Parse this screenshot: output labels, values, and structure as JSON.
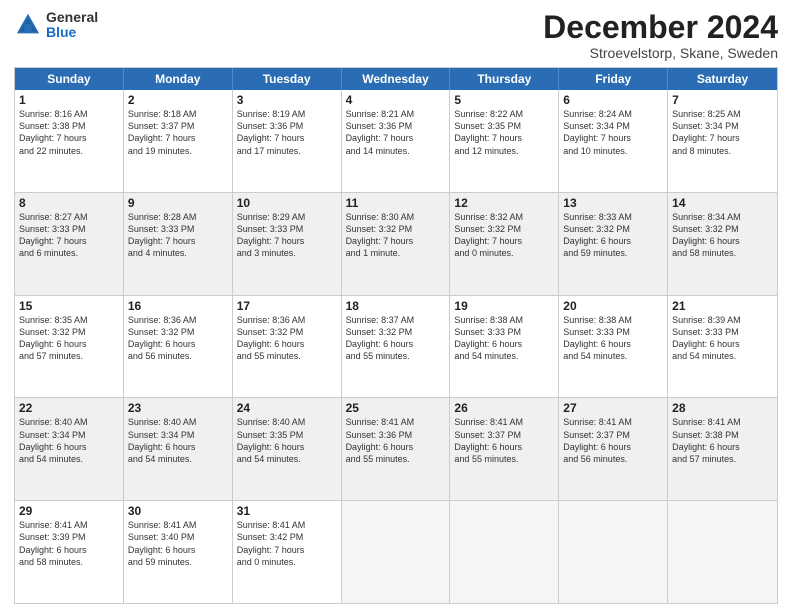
{
  "header": {
    "logo_general": "General",
    "logo_blue": "Blue",
    "title": "December 2024",
    "location": "Stroevelstorp, Skane, Sweden"
  },
  "days_of_week": [
    "Sunday",
    "Monday",
    "Tuesday",
    "Wednesday",
    "Thursday",
    "Friday",
    "Saturday"
  ],
  "weeks": [
    [
      {
        "day": "1",
        "shade": false,
        "lines": [
          "Sunrise: 8:16 AM",
          "Sunset: 3:38 PM",
          "Daylight: 7 hours",
          "and 22 minutes."
        ]
      },
      {
        "day": "2",
        "shade": false,
        "lines": [
          "Sunrise: 8:18 AM",
          "Sunset: 3:37 PM",
          "Daylight: 7 hours",
          "and 19 minutes."
        ]
      },
      {
        "day": "3",
        "shade": false,
        "lines": [
          "Sunrise: 8:19 AM",
          "Sunset: 3:36 PM",
          "Daylight: 7 hours",
          "and 17 minutes."
        ]
      },
      {
        "day": "4",
        "shade": false,
        "lines": [
          "Sunrise: 8:21 AM",
          "Sunset: 3:36 PM",
          "Daylight: 7 hours",
          "and 14 minutes."
        ]
      },
      {
        "day": "5",
        "shade": false,
        "lines": [
          "Sunrise: 8:22 AM",
          "Sunset: 3:35 PM",
          "Daylight: 7 hours",
          "and 12 minutes."
        ]
      },
      {
        "day": "6",
        "shade": false,
        "lines": [
          "Sunrise: 8:24 AM",
          "Sunset: 3:34 PM",
          "Daylight: 7 hours",
          "and 10 minutes."
        ]
      },
      {
        "day": "7",
        "shade": false,
        "lines": [
          "Sunrise: 8:25 AM",
          "Sunset: 3:34 PM",
          "Daylight: 7 hours",
          "and 8 minutes."
        ]
      }
    ],
    [
      {
        "day": "8",
        "shade": true,
        "lines": [
          "Sunrise: 8:27 AM",
          "Sunset: 3:33 PM",
          "Daylight: 7 hours",
          "and 6 minutes."
        ]
      },
      {
        "day": "9",
        "shade": true,
        "lines": [
          "Sunrise: 8:28 AM",
          "Sunset: 3:33 PM",
          "Daylight: 7 hours",
          "and 4 minutes."
        ]
      },
      {
        "day": "10",
        "shade": true,
        "lines": [
          "Sunrise: 8:29 AM",
          "Sunset: 3:33 PM",
          "Daylight: 7 hours",
          "and 3 minutes."
        ]
      },
      {
        "day": "11",
        "shade": true,
        "lines": [
          "Sunrise: 8:30 AM",
          "Sunset: 3:32 PM",
          "Daylight: 7 hours",
          "and 1 minute."
        ]
      },
      {
        "day": "12",
        "shade": true,
        "lines": [
          "Sunrise: 8:32 AM",
          "Sunset: 3:32 PM",
          "Daylight: 7 hours",
          "and 0 minutes."
        ]
      },
      {
        "day": "13",
        "shade": true,
        "lines": [
          "Sunrise: 8:33 AM",
          "Sunset: 3:32 PM",
          "Daylight: 6 hours",
          "and 59 minutes."
        ]
      },
      {
        "day": "14",
        "shade": true,
        "lines": [
          "Sunrise: 8:34 AM",
          "Sunset: 3:32 PM",
          "Daylight: 6 hours",
          "and 58 minutes."
        ]
      }
    ],
    [
      {
        "day": "15",
        "shade": false,
        "lines": [
          "Sunrise: 8:35 AM",
          "Sunset: 3:32 PM",
          "Daylight: 6 hours",
          "and 57 minutes."
        ]
      },
      {
        "day": "16",
        "shade": false,
        "lines": [
          "Sunrise: 8:36 AM",
          "Sunset: 3:32 PM",
          "Daylight: 6 hours",
          "and 56 minutes."
        ]
      },
      {
        "day": "17",
        "shade": false,
        "lines": [
          "Sunrise: 8:36 AM",
          "Sunset: 3:32 PM",
          "Daylight: 6 hours",
          "and 55 minutes."
        ]
      },
      {
        "day": "18",
        "shade": false,
        "lines": [
          "Sunrise: 8:37 AM",
          "Sunset: 3:32 PM",
          "Daylight: 6 hours",
          "and 55 minutes."
        ]
      },
      {
        "day": "19",
        "shade": false,
        "lines": [
          "Sunrise: 8:38 AM",
          "Sunset: 3:33 PM",
          "Daylight: 6 hours",
          "and 54 minutes."
        ]
      },
      {
        "day": "20",
        "shade": false,
        "lines": [
          "Sunrise: 8:38 AM",
          "Sunset: 3:33 PM",
          "Daylight: 6 hours",
          "and 54 minutes."
        ]
      },
      {
        "day": "21",
        "shade": false,
        "lines": [
          "Sunrise: 8:39 AM",
          "Sunset: 3:33 PM",
          "Daylight: 6 hours",
          "and 54 minutes."
        ]
      }
    ],
    [
      {
        "day": "22",
        "shade": true,
        "lines": [
          "Sunrise: 8:40 AM",
          "Sunset: 3:34 PM",
          "Daylight: 6 hours",
          "and 54 minutes."
        ]
      },
      {
        "day": "23",
        "shade": true,
        "lines": [
          "Sunrise: 8:40 AM",
          "Sunset: 3:34 PM",
          "Daylight: 6 hours",
          "and 54 minutes."
        ]
      },
      {
        "day": "24",
        "shade": true,
        "lines": [
          "Sunrise: 8:40 AM",
          "Sunset: 3:35 PM",
          "Daylight: 6 hours",
          "and 54 minutes."
        ]
      },
      {
        "day": "25",
        "shade": true,
        "lines": [
          "Sunrise: 8:41 AM",
          "Sunset: 3:36 PM",
          "Daylight: 6 hours",
          "and 55 minutes."
        ]
      },
      {
        "day": "26",
        "shade": true,
        "lines": [
          "Sunrise: 8:41 AM",
          "Sunset: 3:37 PM",
          "Daylight: 6 hours",
          "and 55 minutes."
        ]
      },
      {
        "day": "27",
        "shade": true,
        "lines": [
          "Sunrise: 8:41 AM",
          "Sunset: 3:37 PM",
          "Daylight: 6 hours",
          "and 56 minutes."
        ]
      },
      {
        "day": "28",
        "shade": true,
        "lines": [
          "Sunrise: 8:41 AM",
          "Sunset: 3:38 PM",
          "Daylight: 6 hours",
          "and 57 minutes."
        ]
      }
    ],
    [
      {
        "day": "29",
        "shade": false,
        "lines": [
          "Sunrise: 8:41 AM",
          "Sunset: 3:39 PM",
          "Daylight: 6 hours",
          "and 58 minutes."
        ]
      },
      {
        "day": "30",
        "shade": false,
        "lines": [
          "Sunrise: 8:41 AM",
          "Sunset: 3:40 PM",
          "Daylight: 6 hours",
          "and 59 minutes."
        ]
      },
      {
        "day": "31",
        "shade": false,
        "lines": [
          "Sunrise: 8:41 AM",
          "Sunset: 3:42 PM",
          "Daylight: 7 hours",
          "and 0 minutes."
        ]
      },
      {
        "day": "",
        "shade": false,
        "lines": []
      },
      {
        "day": "",
        "shade": false,
        "lines": []
      },
      {
        "day": "",
        "shade": false,
        "lines": []
      },
      {
        "day": "",
        "shade": false,
        "lines": []
      }
    ]
  ]
}
